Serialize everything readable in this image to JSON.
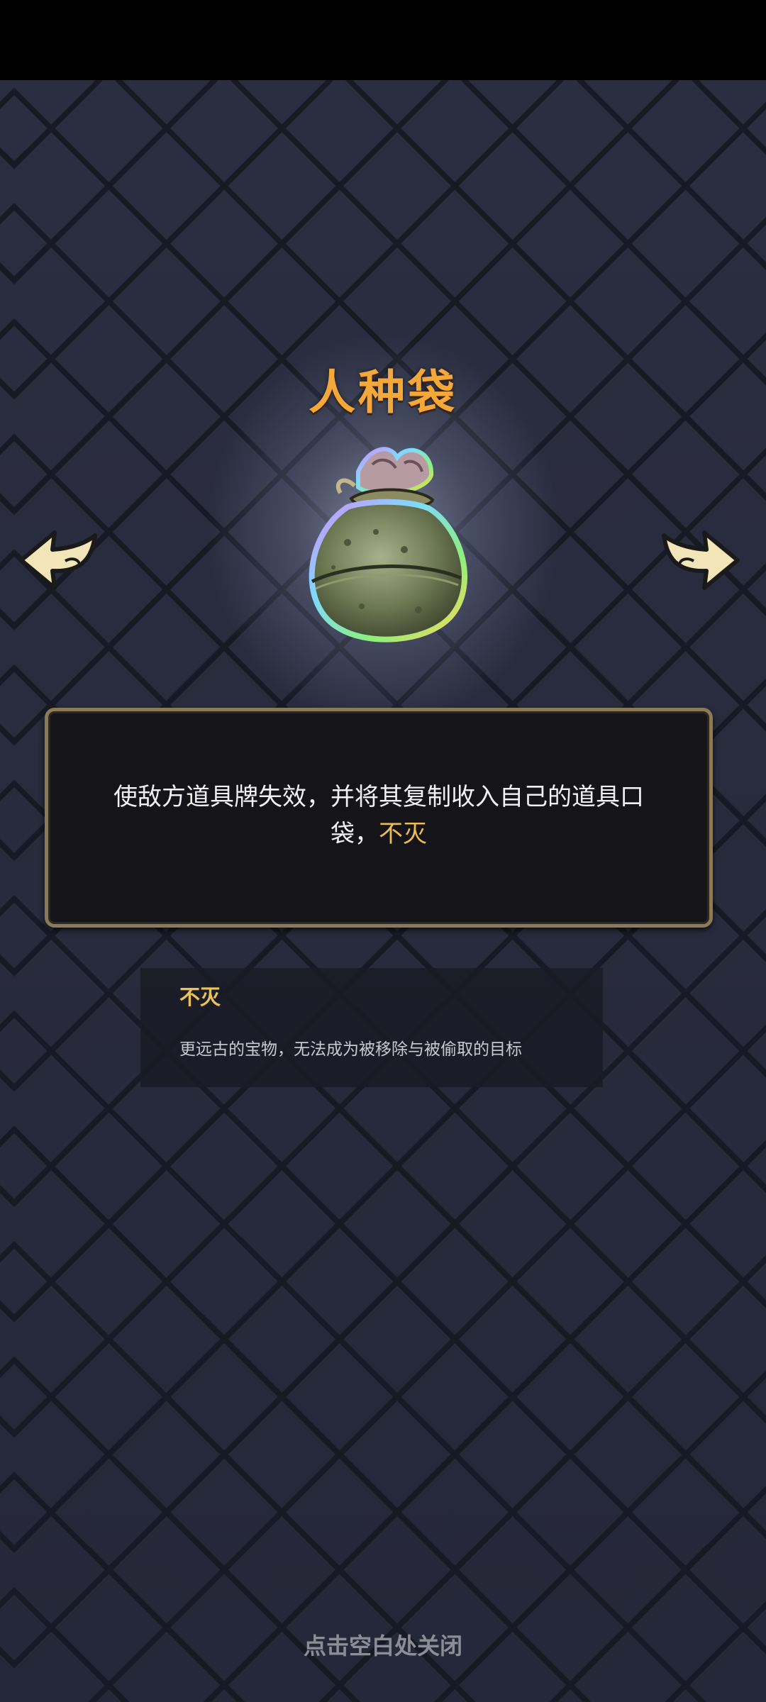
{
  "item": {
    "title": "人种袋",
    "icon": "seed-bag-icon"
  },
  "description": {
    "text": "使敌方道具牌失效，并将其复制收入自己的道具口袋，",
    "keyword": "不灭"
  },
  "keyword_panel": {
    "title": "不灭",
    "description": "更远古的宝物，无法成为被移除与被偷取的目标"
  },
  "navigation": {
    "prev_icon": "arrow-left-icon",
    "next_icon": "arrow-right-icon"
  },
  "footer": {
    "close_hint": "点击空白处关闭"
  },
  "colors": {
    "title": "#f4a83a",
    "keyword": "#e8bd55",
    "panel_border": "#8a7a58",
    "background": "#262939"
  }
}
